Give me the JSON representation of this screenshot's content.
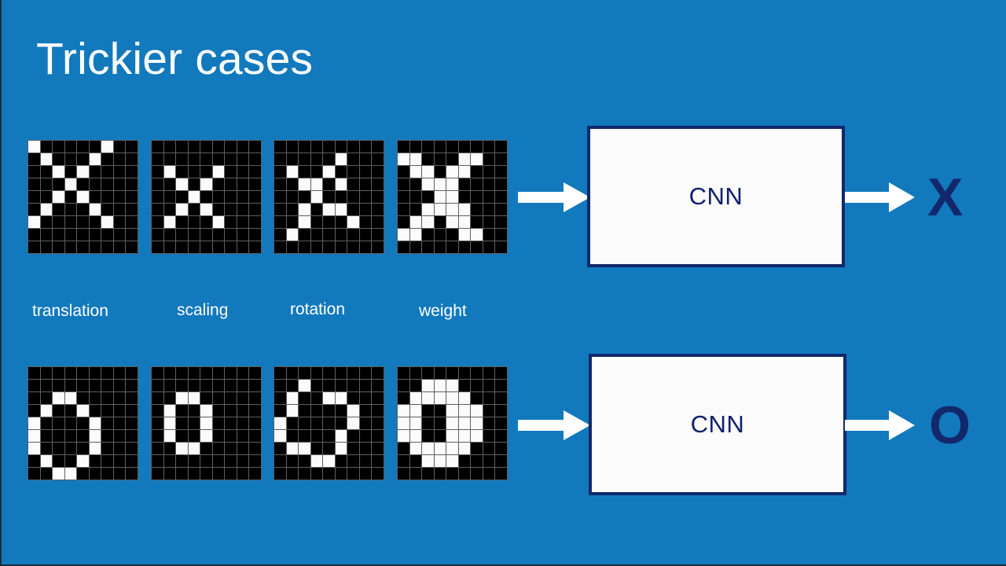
{
  "slide": {
    "title": "Trickier cases",
    "background_color": "#1279bd",
    "accent_navy": "#12286b",
    "panel_fill": "#fbfbfb",
    "cell_on_color": "#fbfbfb",
    "cell_off_color": "#000000",
    "grid_line_color": "#5f5f5f"
  },
  "transform_labels": [
    {
      "text": "translation"
    },
    {
      "text": "scaling"
    },
    {
      "text": "rotation"
    },
    {
      "text": "weight"
    }
  ],
  "rows": [
    {
      "name": "x-row",
      "cnn_label": "CNN",
      "output_letter": "X",
      "sprites": [
        {
          "name": "x-translation",
          "cols": 9,
          "rows": 9,
          "pixels": [
            [
              1,
              0,
              0,
              0,
              0,
              0,
              1,
              0,
              0
            ],
            [
              0,
              1,
              0,
              0,
              0,
              1,
              0,
              0,
              0
            ],
            [
              0,
              0,
              1,
              0,
              1,
              0,
              0,
              0,
              0
            ],
            [
              0,
              0,
              0,
              1,
              0,
              0,
              0,
              0,
              0
            ],
            [
              0,
              0,
              1,
              0,
              1,
              0,
              0,
              0,
              0
            ],
            [
              0,
              1,
              0,
              0,
              0,
              1,
              0,
              0,
              0
            ],
            [
              1,
              0,
              0,
              0,
              0,
              0,
              1,
              0,
              0
            ],
            [
              0,
              0,
              0,
              0,
              0,
              0,
              0,
              0,
              0
            ],
            [
              0,
              0,
              0,
              0,
              0,
              0,
              0,
              0,
              0
            ]
          ]
        },
        {
          "name": "x-scaling",
          "cols": 9,
          "rows": 9,
          "pixels": [
            [
              0,
              0,
              0,
              0,
              0,
              0,
              0,
              0,
              0
            ],
            [
              0,
              0,
              0,
              0,
              0,
              0,
              0,
              0,
              0
            ],
            [
              0,
              1,
              0,
              0,
              0,
              1,
              0,
              0,
              0
            ],
            [
              0,
              0,
              1,
              0,
              1,
              0,
              0,
              0,
              0
            ],
            [
              0,
              0,
              0,
              1,
              0,
              0,
              0,
              0,
              0
            ],
            [
              0,
              0,
              1,
              0,
              1,
              0,
              0,
              0,
              0
            ],
            [
              0,
              1,
              0,
              0,
              0,
              1,
              0,
              0,
              0
            ],
            [
              0,
              0,
              0,
              0,
              0,
              0,
              0,
              0,
              0
            ],
            [
              0,
              0,
              0,
              0,
              0,
              0,
              0,
              0,
              0
            ]
          ]
        },
        {
          "name": "x-rotation",
          "cols": 9,
          "rows": 9,
          "pixels": [
            [
              0,
              0,
              0,
              0,
              0,
              0,
              0,
              0,
              0
            ],
            [
              0,
              0,
              0,
              0,
              0,
              1,
              0,
              0,
              0
            ],
            [
              0,
              1,
              0,
              0,
              1,
              0,
              0,
              0,
              0
            ],
            [
              0,
              0,
              1,
              1,
              0,
              1,
              0,
              0,
              0
            ],
            [
              0,
              0,
              0,
              1,
              0,
              0,
              0,
              0,
              0
            ],
            [
              0,
              0,
              1,
              0,
              1,
              1,
              0,
              0,
              0
            ],
            [
              0,
              0,
              1,
              0,
              0,
              0,
              1,
              0,
              0
            ],
            [
              0,
              1,
              0,
              0,
              0,
              0,
              0,
              0,
              0
            ],
            [
              0,
              0,
              0,
              0,
              0,
              0,
              0,
              0,
              0
            ]
          ]
        },
        {
          "name": "x-weight",
          "cols": 9,
          "rows": 9,
          "pixels": [
            [
              0,
              0,
              0,
              0,
              0,
              0,
              0,
              0,
              0
            ],
            [
              1,
              1,
              0,
              0,
              0,
              1,
              1,
              0,
              0
            ],
            [
              0,
              1,
              1,
              0,
              1,
              1,
              0,
              0,
              0
            ],
            [
              0,
              0,
              1,
              1,
              1,
              0,
              0,
              0,
              0
            ],
            [
              0,
              0,
              0,
              1,
              1,
              0,
              0,
              0,
              0
            ],
            [
              0,
              0,
              1,
              1,
              1,
              1,
              0,
              0,
              0
            ],
            [
              0,
              1,
              1,
              0,
              1,
              1,
              0,
              0,
              0
            ],
            [
              1,
              1,
              0,
              0,
              0,
              1,
              1,
              0,
              0
            ],
            [
              0,
              0,
              0,
              0,
              0,
              0,
              0,
              0,
              0
            ]
          ]
        }
      ]
    },
    {
      "name": "o-row",
      "cnn_label": "CNN",
      "output_letter": "O",
      "sprites": [
        {
          "name": "o-translation",
          "cols": 9,
          "rows": 9,
          "pixels": [
            [
              0,
              0,
              0,
              0,
              0,
              0,
              0,
              0,
              0
            ],
            [
              0,
              0,
              0,
              0,
              0,
              0,
              0,
              0,
              0
            ],
            [
              0,
              0,
              1,
              1,
              0,
              0,
              0,
              0,
              0
            ],
            [
              0,
              1,
              0,
              0,
              1,
              0,
              0,
              0,
              0
            ],
            [
              1,
              0,
              0,
              0,
              0,
              1,
              0,
              0,
              0
            ],
            [
              1,
              0,
              0,
              0,
              0,
              1,
              0,
              0,
              0
            ],
            [
              1,
              0,
              0,
              0,
              0,
              1,
              0,
              0,
              0
            ],
            [
              0,
              1,
              0,
              0,
              1,
              0,
              0,
              0,
              0
            ],
            [
              0,
              0,
              1,
              1,
              0,
              0,
              0,
              0,
              0
            ]
          ]
        },
        {
          "name": "o-scaling",
          "cols": 9,
          "rows": 9,
          "pixels": [
            [
              0,
              0,
              0,
              0,
              0,
              0,
              0,
              0,
              0
            ],
            [
              0,
              0,
              0,
              0,
              0,
              0,
              0,
              0,
              0
            ],
            [
              0,
              0,
              1,
              1,
              0,
              0,
              0,
              0,
              0
            ],
            [
              0,
              1,
              0,
              0,
              1,
              0,
              0,
              0,
              0
            ],
            [
              0,
              1,
              0,
              0,
              1,
              0,
              0,
              0,
              0
            ],
            [
              0,
              1,
              0,
              0,
              1,
              0,
              0,
              0,
              0
            ],
            [
              0,
              0,
              1,
              1,
              0,
              0,
              0,
              0,
              0
            ],
            [
              0,
              0,
              0,
              0,
              0,
              0,
              0,
              0,
              0
            ],
            [
              0,
              0,
              0,
              0,
              0,
              0,
              0,
              0,
              0
            ]
          ]
        },
        {
          "name": "o-rotation",
          "cols": 9,
          "rows": 9,
          "pixels": [
            [
              0,
              0,
              0,
              0,
              0,
              0,
              0,
              0,
              0
            ],
            [
              0,
              0,
              1,
              0,
              0,
              0,
              0,
              0,
              0
            ],
            [
              0,
              1,
              0,
              0,
              1,
              1,
              0,
              0,
              0
            ],
            [
              0,
              1,
              0,
              0,
              0,
              0,
              1,
              0,
              0
            ],
            [
              1,
              0,
              0,
              0,
              0,
              0,
              1,
              0,
              0
            ],
            [
              1,
              0,
              0,
              0,
              0,
              1,
              0,
              0,
              0
            ],
            [
              0,
              1,
              1,
              0,
              0,
              1,
              0,
              0,
              0
            ],
            [
              0,
              0,
              0,
              1,
              1,
              0,
              0,
              0,
              0
            ],
            [
              0,
              0,
              0,
              0,
              0,
              0,
              0,
              0,
              0
            ]
          ]
        },
        {
          "name": "o-weight",
          "cols": 9,
          "rows": 9,
          "pixels": [
            [
              0,
              0,
              0,
              0,
              0,
              0,
              0,
              0,
              0
            ],
            [
              0,
              0,
              1,
              1,
              1,
              0,
              0,
              0,
              0
            ],
            [
              0,
              1,
              1,
              1,
              1,
              1,
              0,
              0,
              0
            ],
            [
              1,
              1,
              0,
              0,
              1,
              1,
              1,
              0,
              0
            ],
            [
              1,
              1,
              0,
              0,
              1,
              1,
              1,
              0,
              0
            ],
            [
              1,
              1,
              0,
              0,
              1,
              1,
              1,
              0,
              0
            ],
            [
              0,
              1,
              1,
              1,
              1,
              1,
              0,
              0,
              0
            ],
            [
              0,
              0,
              1,
              1,
              1,
              0,
              0,
              0,
              0
            ],
            [
              0,
              0,
              0,
              0,
              0,
              0,
              0,
              0,
              0
            ]
          ]
        }
      ]
    }
  ]
}
